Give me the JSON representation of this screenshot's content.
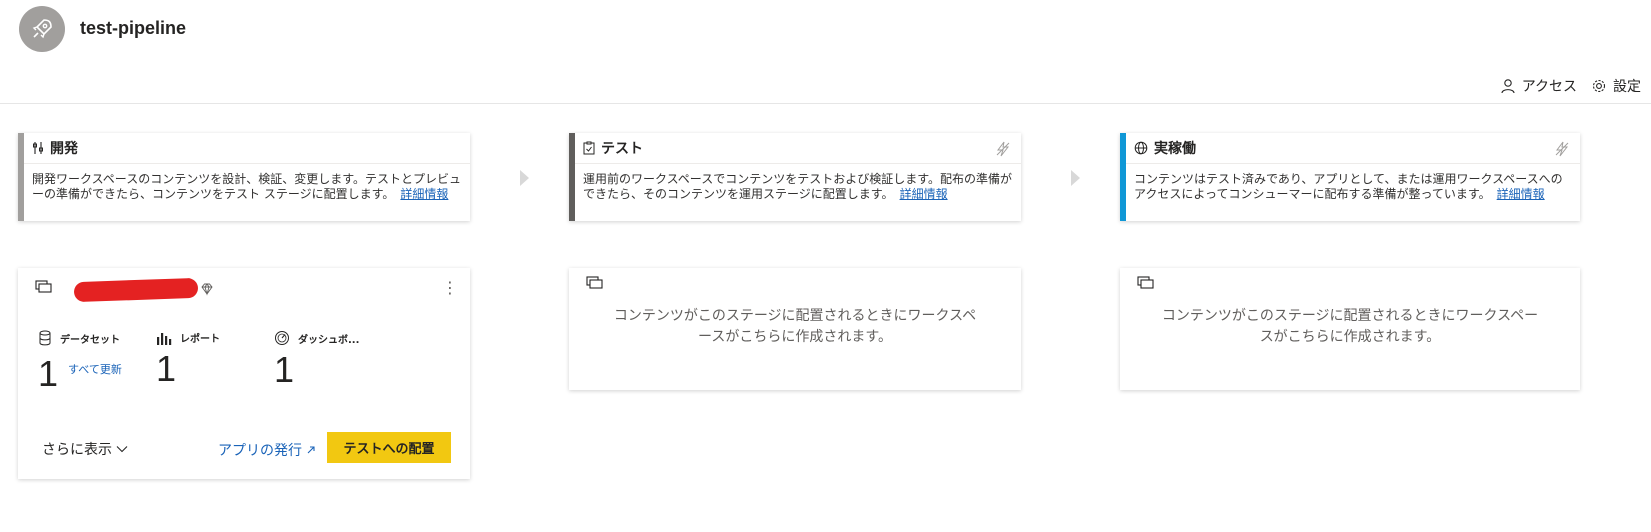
{
  "header": {
    "pipeline_title": "test-pipeline",
    "access_label": "アクセス",
    "settings_label": "設定"
  },
  "stages": [
    {
      "title": "開発",
      "description": "開発ワークスペースのコンテンツを設計、検証、変更します。テストとプレビューの準備ができたら、コンテンツをテスト ステージに配置します。",
      "learn_more": "詳細情報",
      "accent_color": "#a19f9d"
    },
    {
      "title": "テスト",
      "description": "運用前のワークスペースでコンテンツをテストおよび検証します。配布の準備ができたら、そのコンテンツを運用ステージに配置します。",
      "learn_more": "詳細情報",
      "accent_color": "#605e5c"
    },
    {
      "title": "実稼働",
      "description": "コンテンツはテスト済みであり、アプリとして、または運用ワークスペースへのアクセスによってコンシューマーに配布する準備が整っています。",
      "learn_more": "詳細情報",
      "accent_color": "#0f97d6"
    }
  ],
  "dev_workspace": {
    "metrics": [
      {
        "label": "データセット",
        "value": "1",
        "icon": "database-icon"
      },
      {
        "label": "レポート",
        "value": "1",
        "icon": "bar-chart-icon"
      },
      {
        "label": "ダッシュボ...",
        "value": "1",
        "icon": "gauge-icon"
      }
    ],
    "refresh_all": "すべて更新",
    "show_more": "さらに表示",
    "publish_app": "アプリの発行",
    "deploy_button": "テストへの配置"
  },
  "placeholder_text": "コンテンツがこのステージに配置されるときにワークスペースがこちらに作成されます。",
  "colors": {
    "deploy_button": "#f2c811",
    "link": "#1a63b8",
    "avatar": "#a19f9d"
  }
}
